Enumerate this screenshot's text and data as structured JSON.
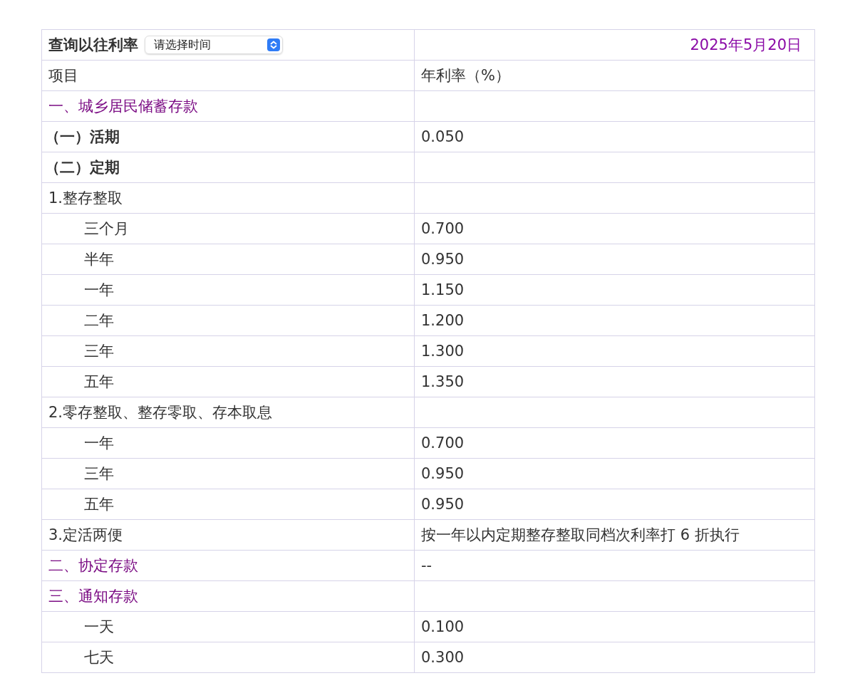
{
  "query": {
    "label": "查询以往利率",
    "select": {
      "value": "请选择时间"
    },
    "date": "2025年5月20日"
  },
  "columns": [
    "项目",
    "年利率（%）"
  ],
  "rows": [
    {
      "kind": "section",
      "item": "一、城乡居民储蓄存款"
    },
    {
      "kind": "category",
      "item": "（一）活期",
      "rate": "0.050"
    },
    {
      "kind": "category",
      "item": "（二）定期"
    },
    {
      "kind": "group",
      "item": "1.整存整取"
    },
    {
      "kind": "item",
      "item": "三个月",
      "rate": "0.700"
    },
    {
      "kind": "item",
      "item": "半年",
      "rate": "0.950"
    },
    {
      "kind": "item",
      "item": "一年",
      "rate": "1.150"
    },
    {
      "kind": "item",
      "item": "二年",
      "rate": "1.200"
    },
    {
      "kind": "item",
      "item": "三年",
      "rate": "1.300"
    },
    {
      "kind": "item",
      "item": "五年",
      "rate": "1.350"
    },
    {
      "kind": "group",
      "item": "2.零存整取、整存零取、存本取息"
    },
    {
      "kind": "item",
      "item": "一年",
      "rate": "0.700"
    },
    {
      "kind": "item",
      "item": "三年",
      "rate": "0.950"
    },
    {
      "kind": "item",
      "item": "五年",
      "rate": "0.950"
    },
    {
      "kind": "group",
      "item": "3.定活两便",
      "rate": "按一年以内定期整存整取同档次利率打 6 折执行"
    },
    {
      "kind": "section",
      "item": "二、协定存款",
      "rate": "--"
    },
    {
      "kind": "section",
      "item": "三、通知存款"
    },
    {
      "kind": "item",
      "item": "一天",
      "rate": "0.100"
    },
    {
      "kind": "item",
      "item": "七天",
      "rate": "0.300"
    }
  ]
}
